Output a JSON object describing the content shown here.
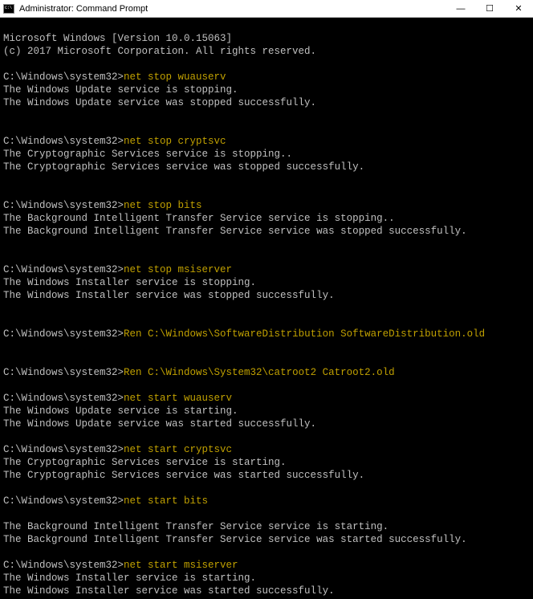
{
  "window": {
    "title": "Administrator: Command Prompt"
  },
  "banner": {
    "line1": "Microsoft Windows [Version 10.0.15063]",
    "line2": "(c) 2017 Microsoft Corporation. All rights reserved."
  },
  "prompt": "C:\\Windows\\system32>",
  "blocks": [
    {
      "cmd": "net stop wuauserv",
      "out1": "The Windows Update service is stopping.",
      "out2": "The Windows Update service was stopped successfully."
    },
    {
      "cmd": "net stop cryptsvc",
      "out1": "The Cryptographic Services service is stopping..",
      "out2": "The Cryptographic Services service was stopped successfully."
    },
    {
      "cmd": "net stop bits",
      "out1": "The Background Intelligent Transfer Service service is stopping..",
      "out2": "The Background Intelligent Transfer Service service was stopped successfully."
    },
    {
      "cmd": "net stop msiserver",
      "out1": "The Windows Installer service is stopping.",
      "out2": "The Windows Installer service was stopped successfully."
    }
  ],
  "ren1": "Ren C:\\Windows\\SoftwareDistribution SoftwareDistribution.old",
  "ren2": "Ren C:\\Windows\\System32\\catroot2 Catroot2.old",
  "startBlocks": [
    {
      "cmd": "net start wuauserv",
      "out1": "The Windows Update service is starting.",
      "out2": "The Windows Update service was started successfully."
    },
    {
      "cmd": "net start cryptsvc",
      "out1": "The Cryptographic Services service is starting.",
      "out2": "The Cryptographic Services service was started successfully."
    },
    {
      "cmd": "net start bits",
      "out1": "The Background Intelligent Transfer Service service is starting.",
      "out2": "The Background Intelligent Transfer Service service was started successfully."
    },
    {
      "cmd": "net start msiserver",
      "out1": "The Windows Installer service is starting.",
      "out2": "The Windows Installer service was started successfully."
    }
  ]
}
